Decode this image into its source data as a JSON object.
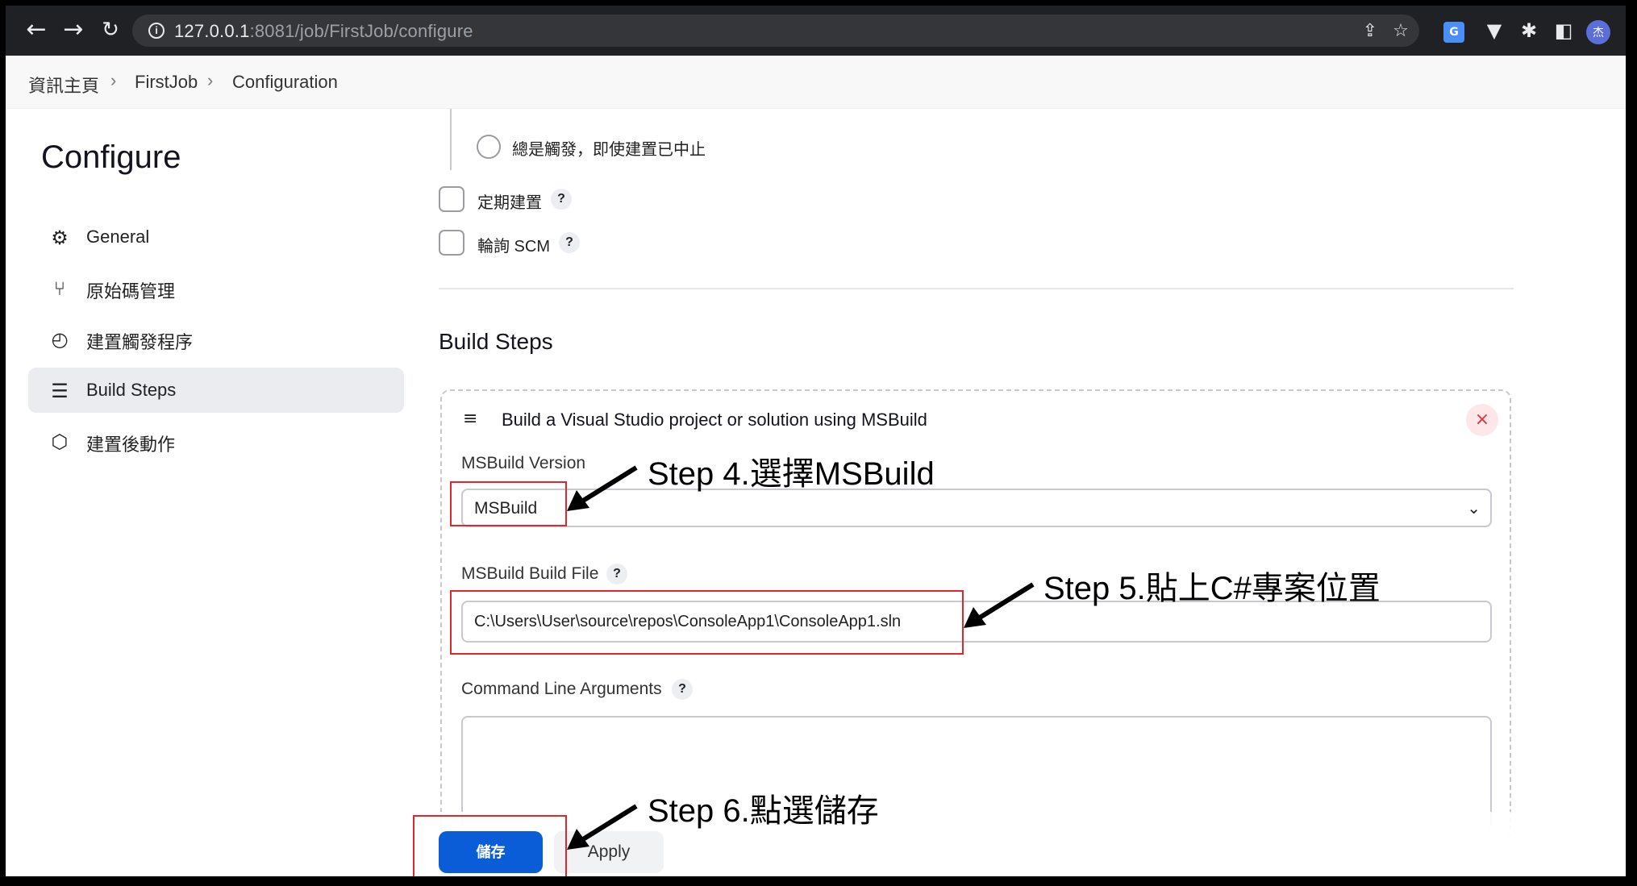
{
  "browser": {
    "url_host": "127.0.0.1",
    "url_rest": ":8081/job/FirstJob/configure",
    "avatar_text": "杰"
  },
  "breadcrumb": [
    "資訊主頁",
    "FirstJob",
    "Configuration"
  ],
  "sidebar": {
    "title": "Configure",
    "items": [
      {
        "label": "General",
        "icon": "gear-icon"
      },
      {
        "label": "原始碼管理",
        "icon": "branch-icon"
      },
      {
        "label": "建置觸發程序",
        "icon": "clock-icon"
      },
      {
        "label": "Build Steps",
        "icon": "list-icon",
        "active": true
      },
      {
        "label": "建置後動作",
        "icon": "cube-icon"
      }
    ]
  },
  "triggers": {
    "radio_label": "總是觸發，即使建置已中止",
    "periodic_label": "定期建置",
    "poll_label": "輪詢 SCM",
    "help": "?"
  },
  "build_steps": {
    "section_title": "Build Steps",
    "card_title": "Build a Visual Studio project or solution using MSBuild",
    "close": "×",
    "msbuild_version_label": "MSBuild Version",
    "msbuild_version_value": "MSBuild",
    "build_file_label": "MSBuild Build File",
    "build_file_value": "C:\\Users\\User\\source\\repos\\ConsoleApp1\\ConsoleApp1.sln",
    "cmd_args_label": "Command Line Arguments"
  },
  "buttons": {
    "save": "儲存",
    "apply": "Apply"
  },
  "annotations": {
    "step4": "Step 4.選擇MSBuild",
    "step5": "Step 5.貼上C#專案位置",
    "step6": "Step 6.點選儲存"
  },
  "colors": {
    "primary": "#0b5cd7",
    "annotation_box": "#e3262b"
  }
}
